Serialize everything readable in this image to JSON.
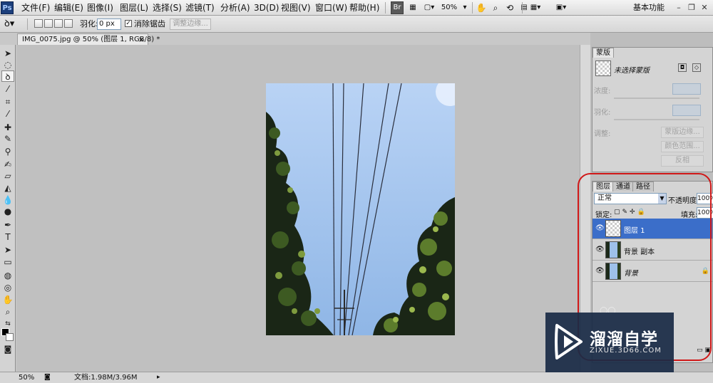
{
  "menubar": {
    "logo": "Ps",
    "items": [
      "文件(F)",
      "编辑(E)",
      "图像(I)",
      "图层(L)",
      "选择(S)",
      "滤镜(T)",
      "分析(A)",
      "3D(D)",
      "视图(V)",
      "窗口(W)",
      "帮助(H)"
    ],
    "bridge_label": "Br",
    "zoom": "50%",
    "workspace": "基本功能"
  },
  "options": {
    "feather_label": "羽化:",
    "feather_value": "0 px",
    "antialias_label": "消除锯齿",
    "antialias_checked": true,
    "refine_edge": "调整边缘..."
  },
  "document": {
    "tab_title": "IMG_0075.jpg @ 50% (图层 1, RGB/8) *"
  },
  "status": {
    "zoom": "50%",
    "doc_info": "文档:1.98M/3.96M"
  },
  "masks_panel": {
    "tab": "蒙版",
    "no_mask": "未选择蒙版",
    "density_label": "浓度:",
    "feather_label": "羽化:",
    "refine_label": "调整:",
    "mask_edge": "蒙版边缘...",
    "color_range": "颜色范围...",
    "invert": "反相"
  },
  "layers_panel": {
    "tabs": [
      "图层",
      "通道",
      "路径"
    ],
    "blend_mode": "正常",
    "opacity_label": "不透明度:",
    "opacity_value": "100%",
    "lock_label": "锁定:",
    "fill_label": "填充:",
    "fill_value": "100%",
    "layers": [
      {
        "name": "图层 1",
        "selected": true
      },
      {
        "name": "背景 副本",
        "selected": false
      },
      {
        "name": "背景",
        "selected": false,
        "locked": true
      }
    ]
  },
  "watermark": {
    "title": "溜溜自学",
    "subtitle": "ZIXUE.3D66.COM"
  },
  "colors": {
    "selection": "#3b6ec9",
    "annotation": "#d01818",
    "sky": "#a8c8f0"
  }
}
